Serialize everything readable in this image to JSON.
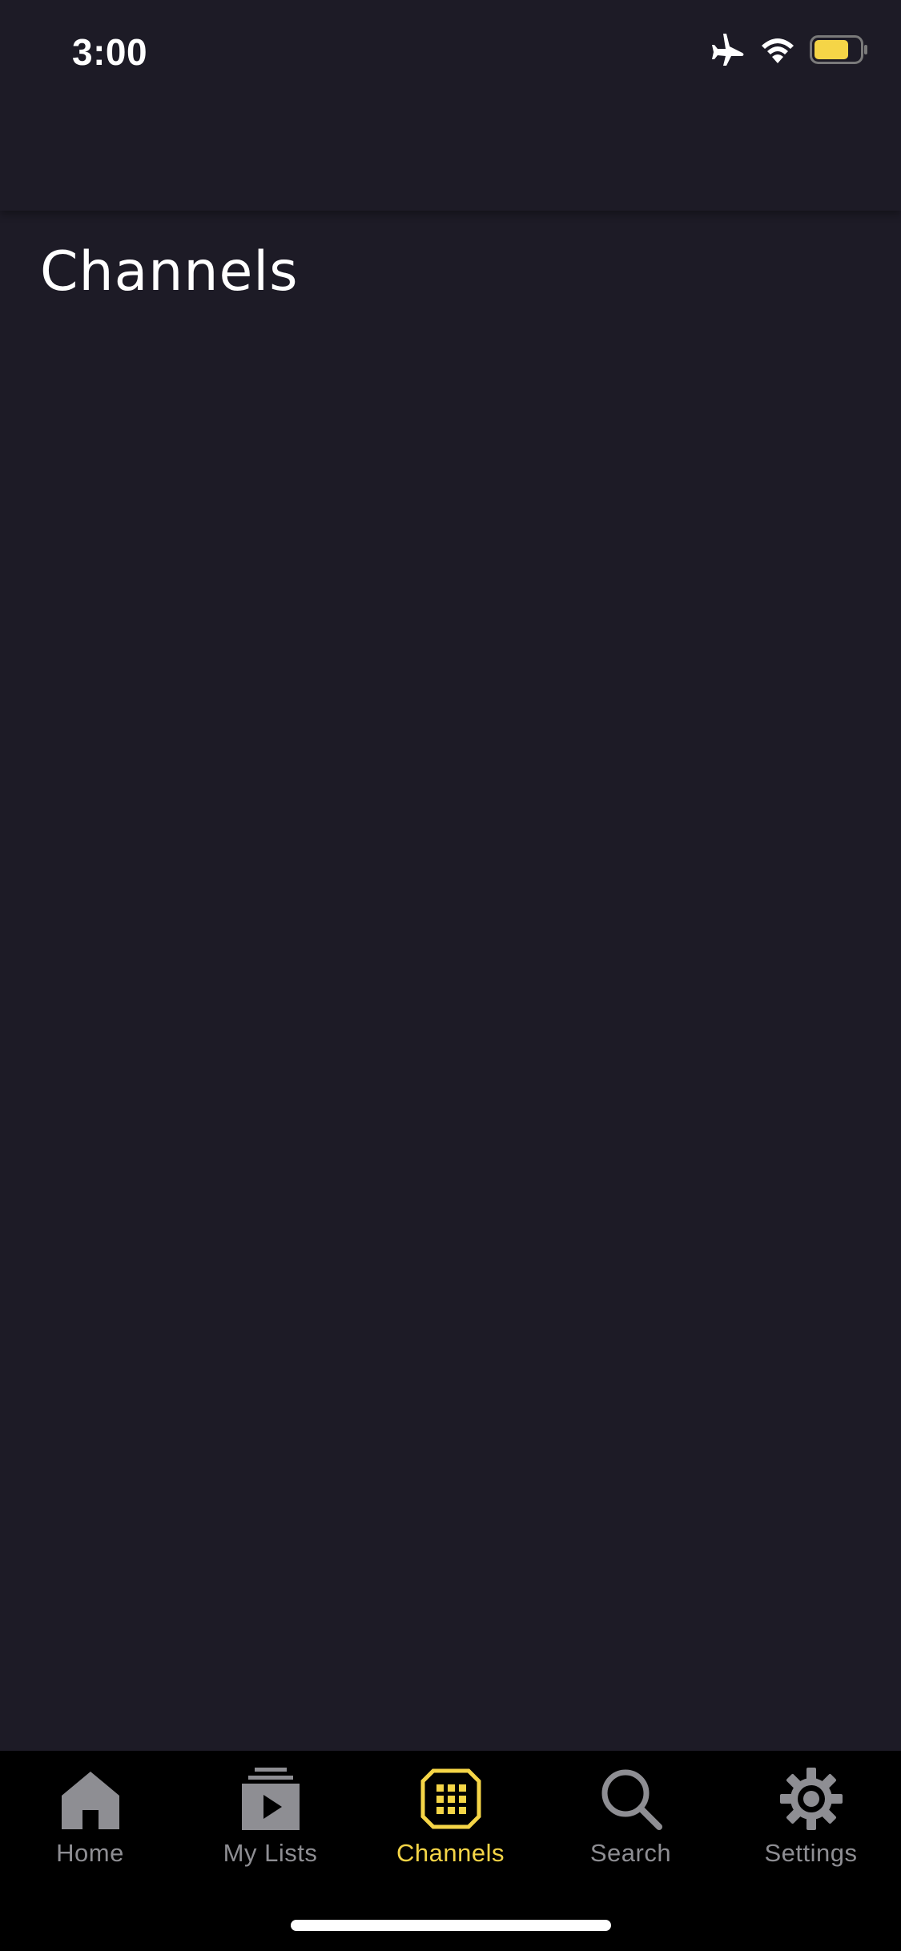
{
  "status_bar": {
    "time": "3:00",
    "icons": [
      "airplane-icon",
      "wifi-icon",
      "battery-icon"
    ],
    "battery_color": "#f5d547"
  },
  "page": {
    "title": "Channels"
  },
  "tab_bar": {
    "active_color": "#f5d547",
    "inactive_color": "#8e8e93",
    "tabs": [
      {
        "label": "Home",
        "icon": "home-icon",
        "active": false
      },
      {
        "label": "My Lists",
        "icon": "my-lists-icon",
        "active": false
      },
      {
        "label": "Channels",
        "icon": "channels-grid-icon",
        "active": true
      },
      {
        "label": "Search",
        "icon": "search-icon",
        "active": false
      },
      {
        "label": "Settings",
        "icon": "gear-icon",
        "active": false
      }
    ]
  }
}
